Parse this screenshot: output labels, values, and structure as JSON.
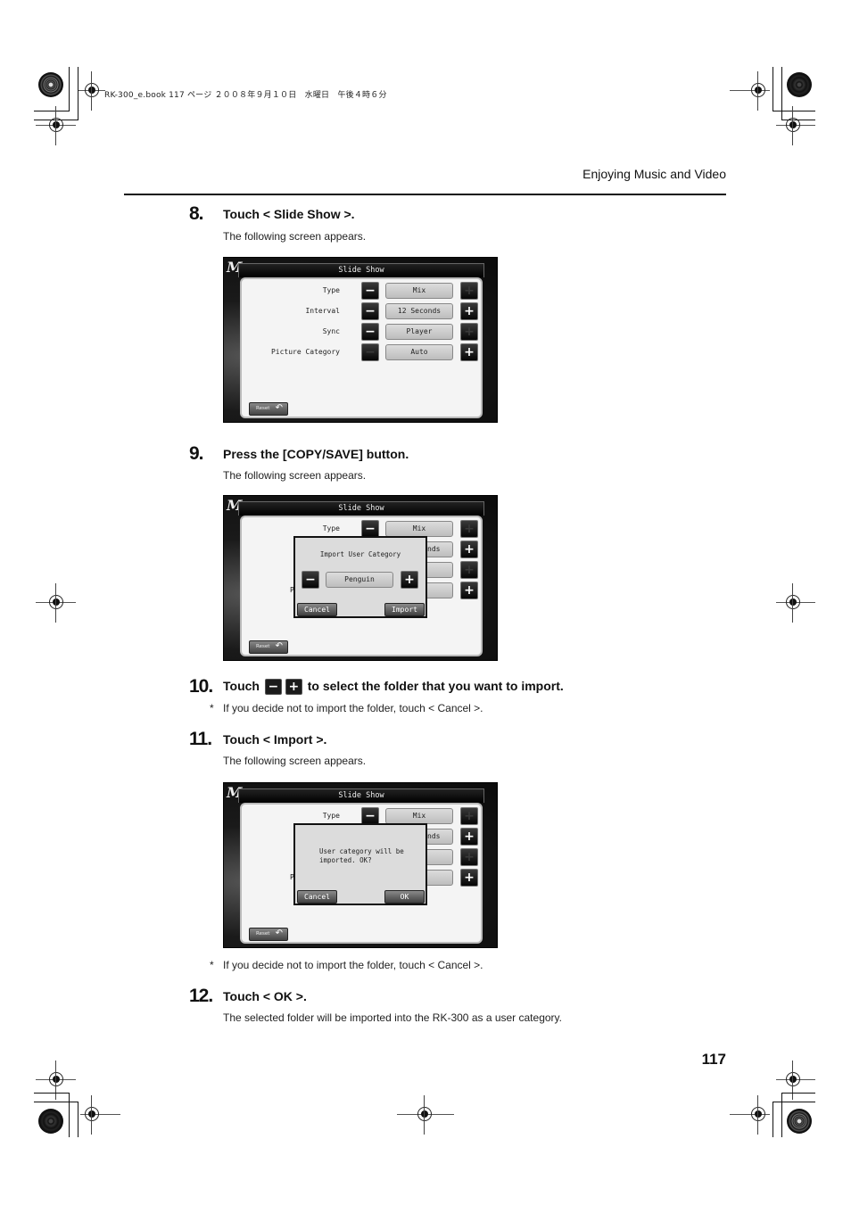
{
  "print_header": "RK-300_e.book  117 ページ  ２００８年９月１０日　水曜日　午後４時６分",
  "section_title": "Enjoying Music and Video",
  "page_number": "117",
  "steps": [
    {
      "number": "8.",
      "title": "Touch < Slide Show >.",
      "body": "The following screen appears."
    },
    {
      "number": "9.",
      "title": "Press the [COPY/SAVE] button.",
      "body": "The following screen appears."
    },
    {
      "number": "10.",
      "title_prefix": "Touch",
      "title_suffix": "to select the folder that you want to import.",
      "minus_glyph": "−",
      "plus_glyph": "+",
      "note": "If you decide not to import the folder, touch < Cancel >."
    },
    {
      "number": "11.",
      "title": "Touch < Import >.",
      "body": "The following screen appears.",
      "note": "If you decide not to import the folder, touch < Cancel >."
    },
    {
      "number": "12.",
      "title": "Touch < OK >.",
      "body": "The selected folder will be imported into the RK-300 as a user category."
    }
  ],
  "note_marker": "*",
  "screens": {
    "logo": "M",
    "title": "Slide Show",
    "reset_label": "Reset",
    "reset_icon": "↶",
    "minus": "−",
    "plus": "+",
    "rows": [
      {
        "label": "Type",
        "value": "Mix",
        "minus_enabled": true,
        "plus_enabled": false
      },
      {
        "label": "Interval",
        "value": "12 Seconds",
        "minus_enabled": true,
        "plus_enabled": true
      },
      {
        "label": "Sync",
        "value": "Player",
        "minus_enabled": true,
        "plus_enabled": false
      },
      {
        "label": "Picture Category",
        "value": "Auto",
        "minus_enabled": false,
        "plus_enabled": true
      }
    ],
    "partial_interval_value": "nds",
    "partial_label": "P",
    "import_dialog": {
      "title": "Import User Category",
      "value": "Penguin",
      "cancel": "Cancel",
      "import": "Import"
    },
    "confirm_dialog": {
      "message_line1": "User category will be",
      "message_line2": "imported. OK?",
      "cancel": "Cancel",
      "ok": "OK"
    }
  }
}
